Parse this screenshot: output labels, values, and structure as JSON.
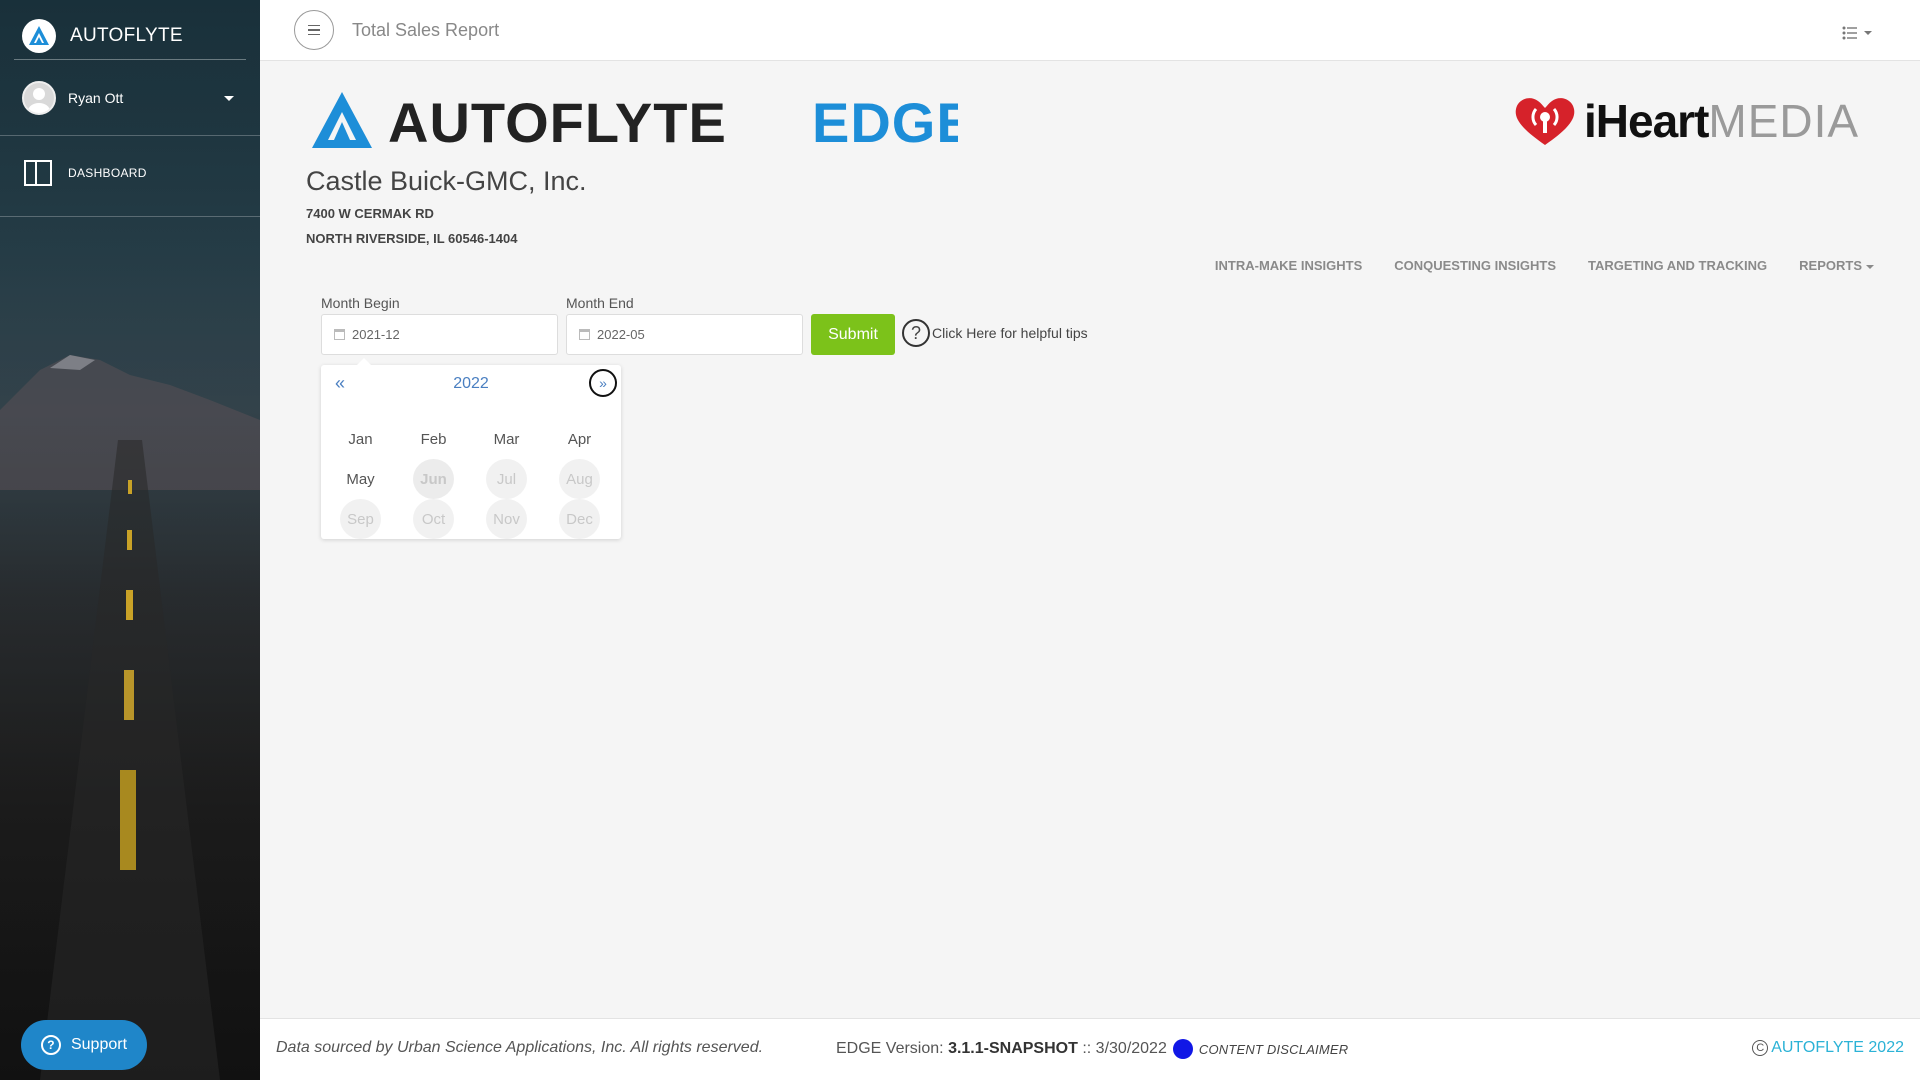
{
  "colors": {
    "accent_green": "#7cc21a",
    "link_blue": "#4a7fc1",
    "support_blue": "#1f86c9",
    "footer_link": "#2bb2d6",
    "status_dot": "#1117e6"
  },
  "sidebar": {
    "brand_name": "AUTOFLYTE",
    "user_name": "Ryan Ott",
    "nav": [
      {
        "label": "DASHBOARD",
        "icon": "dashboard-columns-icon"
      }
    ],
    "support_label": "Support"
  },
  "topbar": {
    "title": "Total Sales Report"
  },
  "header": {
    "logo_text_main": "AUTOFLYTE",
    "logo_text_accent": "EDGE",
    "partner_logo_bold": "iHeart",
    "partner_logo_light": "MEDIA",
    "company_name": "Castle Buick-GMC, Inc.",
    "address_line1": "7400 W CERMAK RD",
    "address_line2": "NORTH RIVERSIDE, IL 60546-1404"
  },
  "nav": {
    "items": [
      "INTRA-MAKE INSIGHTS",
      "CONQUESTING INSIGHTS",
      "TARGETING AND TRACKING",
      "REPORTS"
    ]
  },
  "form": {
    "month_begin_label": "Month Begin",
    "month_begin_value": "2021-12",
    "month_end_label": "Month End",
    "month_end_value": "2022-05",
    "submit_label": "Submit",
    "help_text": "Click Here for helpful tips"
  },
  "picker": {
    "prev": "«",
    "year": "2022",
    "next": "»",
    "months": [
      "Jan",
      "Feb",
      "Mar",
      "Apr",
      "May",
      "Jun",
      "Jul",
      "Aug",
      "Sep",
      "Oct",
      "Nov",
      "Dec"
    ]
  },
  "footer": {
    "source_text": "Data sourced by Urban Science Applications, Inc. All rights reserved.",
    "version_label": "EDGE Version:",
    "version_value": "3.1.1-SNAPSHOT",
    "version_sep": "::",
    "version_date": "3/30/2022",
    "disclaimer": "CONTENT DISCLAIMER",
    "copyright": "AUTOFLYTE 2022"
  }
}
